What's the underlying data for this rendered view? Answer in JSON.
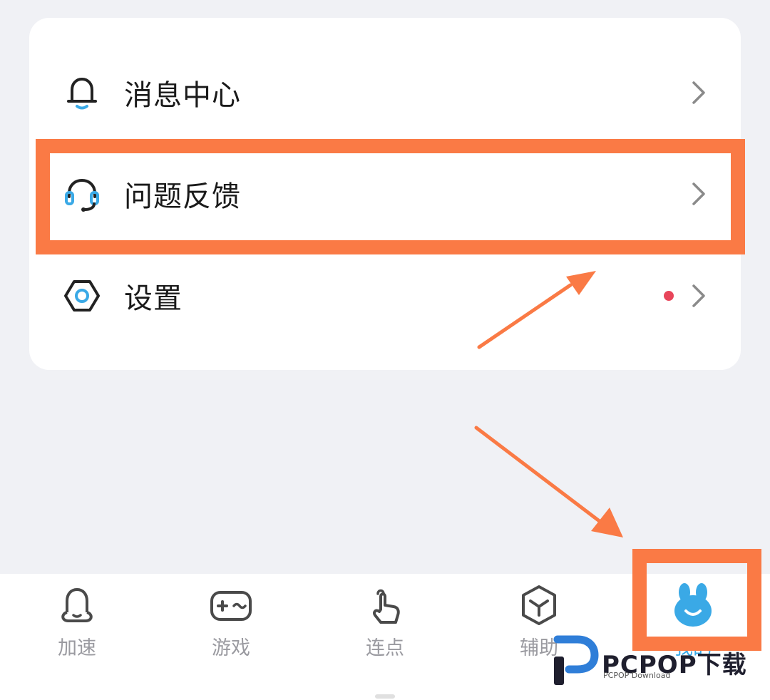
{
  "menu": {
    "items": [
      {
        "label": "消息中心",
        "icon": "bell-icon"
      },
      {
        "label": "问题反馈",
        "icon": "headset-icon"
      },
      {
        "label": "设置",
        "icon": "hexagon-settings-icon",
        "badge": true
      }
    ]
  },
  "tabbar": {
    "tabs": [
      {
        "label": "加速",
        "icon": "bell-ghost-icon"
      },
      {
        "label": "游戏",
        "icon": "gamepad-icon"
      },
      {
        "label": "连点",
        "icon": "tap-hand-icon"
      },
      {
        "label": "辅助",
        "icon": "cube-icon"
      },
      {
        "label": "我的",
        "icon": "bunny-avatar-icon",
        "active": true
      }
    ]
  },
  "watermark": {
    "brand": "PCPOP下载",
    "sub": "PCPOP Download"
  },
  "colors": {
    "annotation": "#fa7a45",
    "accent": "#3aa9e6",
    "badge": "#e8455a"
  }
}
